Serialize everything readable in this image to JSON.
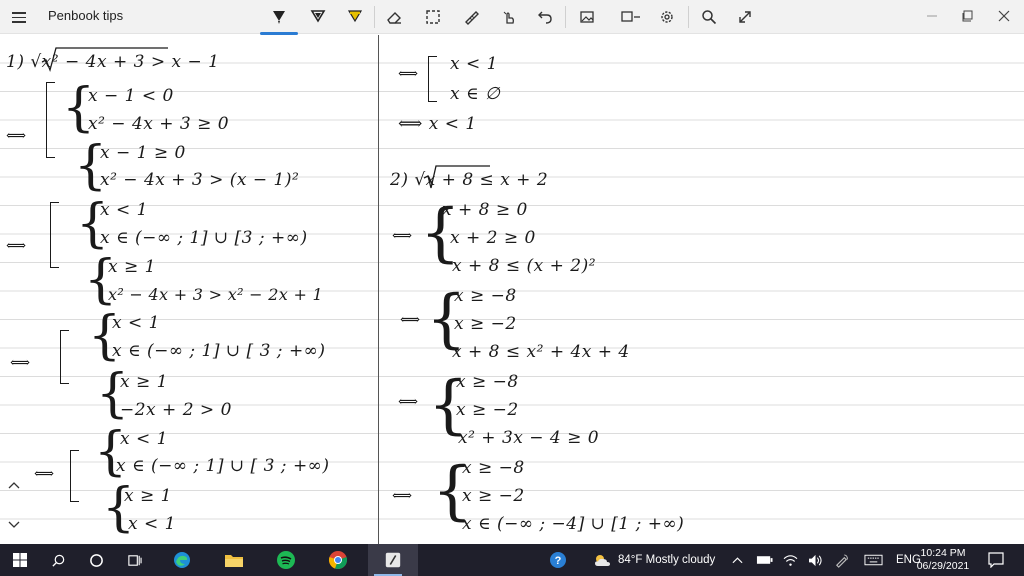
{
  "window": {
    "title": "Penbook tips"
  },
  "toolbar": {
    "tools": [
      "pen-icon",
      "pen-icon",
      "highlighter-icon",
      "eraser-icon",
      "lasso-icon",
      "ruler-icon",
      "touch-icon",
      "undo-icon",
      "image-icon",
      "shape-icon",
      "settings-icon",
      "search-icon",
      "fullscreen-icon"
    ],
    "active_tool": "pen-icon",
    "accent": "#2b7cd3",
    "highlighter_color": "#e5c000"
  },
  "notes": {
    "left": [
      "1)  √x² − 4x + 3  > x − 1",
      "x − 1 < 0",
      "x² − 4x + 3 ≥ 0",
      "⟺",
      "x − 1 ≥ 0",
      "x² − 4x + 3 > (x − 1)²",
      "x < 1",
      "x ∈ (−∞ ; 1] ∪ [3 ; +∞)",
      "⟺",
      "x ≥ 1",
      "x² − 4x + 3 > x² − 2x + 1",
      "x < 1",
      "x ∈ (−∞ ; 1] ∪ [ 3 ; +∞)",
      "⟺",
      "x ≥ 1",
      "−2x + 2 > 0",
      "x < 1",
      "x ∈ (−∞ ; 1] ∪ [ 3 ; +∞)",
      "⟺",
      "x ≥ 1",
      "x < 1"
    ],
    "right": [
      "⟺",
      "x < 1",
      "x ∈ ∅",
      "⟺   x < 1",
      "2)  √x + 8  ≤ x + 2",
      "x + 8 ≥ 0",
      "⟺",
      "x + 2 ≥ 0",
      "x + 8 ≤ (x + 2)²",
      "x ≥ −8",
      "⟺",
      "x ≥ −2",
      "x + 8 ≤ x² + 4x + 4",
      "x ≥ −8",
      "⟺",
      "x ≥ −2",
      "x² + 3x − 4 ≥ 0",
      "x ≥ −8",
      "⟺",
      "x ≥ −2",
      "x ∈ (−∞ ; −4] ∪ [1 ; +∞)"
    ]
  },
  "taskbar": {
    "weather": "84°F  Mostly cloudy",
    "language": "ENG",
    "time": "10:24 PM",
    "date": "06/29/2021",
    "apps": [
      "windows-start-icon",
      "search-icon",
      "cortana-icon",
      "task-view-icon",
      "edge-icon",
      "file-explorer-icon",
      "spotify-icon",
      "chrome-icon",
      "penbook-icon"
    ]
  }
}
